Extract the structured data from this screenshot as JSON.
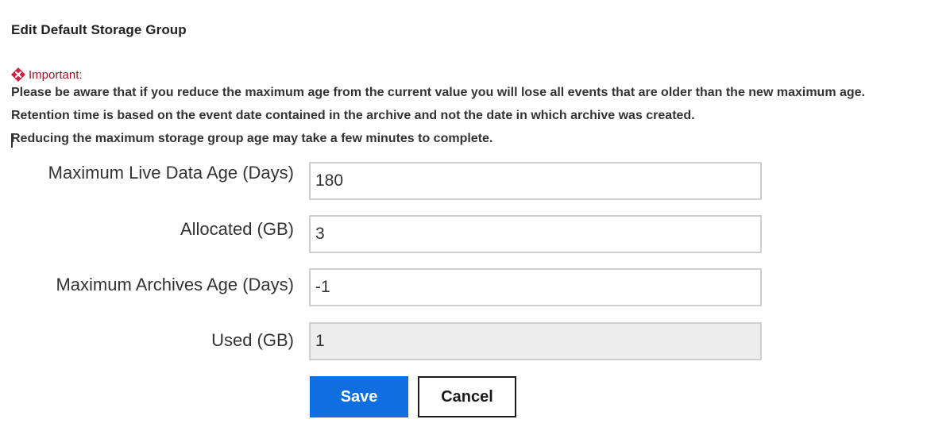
{
  "dialog": {
    "title": "Edit Default Storage Group"
  },
  "important": {
    "icon": "error-diamond-icon",
    "icon_color": "#d0213c",
    "label": "Important:",
    "label_color": "#a11227",
    "notes": [
      "Please be aware that if you reduce the maximum age from the current value you will lose all events that are older than the new maximum age.",
      "Retention time is based on the event date contained in the archive and not the date in which archive was created.",
      "Reducing the maximum storage group age may take a few minutes to complete."
    ]
  },
  "fields": {
    "max_live_data_age": {
      "label": "Maximum Live Data Age (Days)",
      "value": "180"
    },
    "allocated": {
      "label": "Allocated (GB)",
      "value": "3"
    },
    "max_archives_age": {
      "label": "Maximum Archives Age (Days)",
      "value": "-1"
    },
    "used": {
      "label": "Used (GB)",
      "value": "1",
      "disabled": true
    }
  },
  "buttons": {
    "save_label": "Save",
    "cancel_label": "Cancel",
    "save_color": "#0f6fe0"
  }
}
